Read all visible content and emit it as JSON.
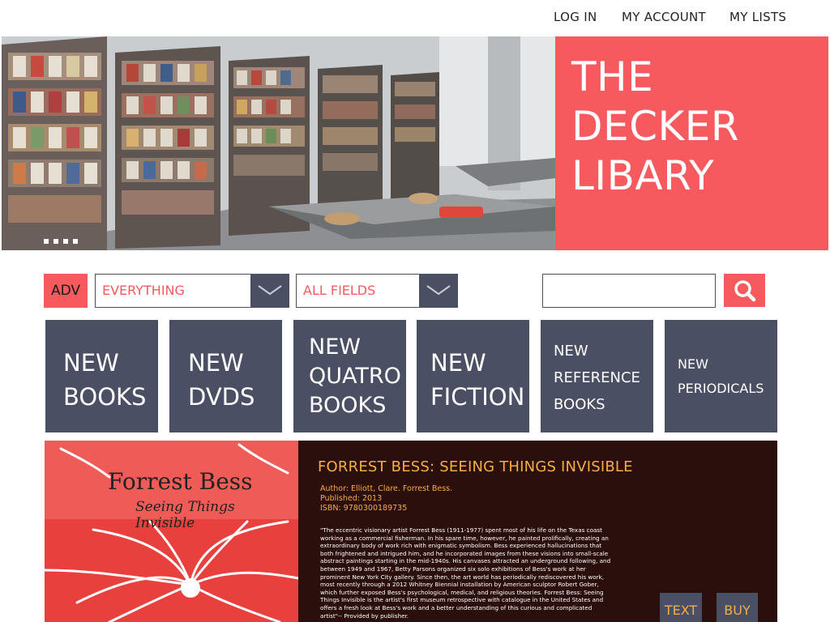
{
  "topnav": {
    "login": "LOG IN",
    "account": "MY ACCOUNT",
    "lists": "MY LISTS"
  },
  "hero": {
    "title_line1": "THE",
    "title_line2": "DECKER",
    "title_line3": "LIBARY",
    "carousel_dots": 4
  },
  "search": {
    "adv_label": "ADV",
    "scope_select": "EVERYTHING",
    "field_select": "ALL FIELDS",
    "query": ""
  },
  "tiles": [
    {
      "line1": "NEW",
      "line2": "BOOKS"
    },
    {
      "line1": "NEW",
      "line2": "DVDS"
    },
    {
      "line1": "NEW",
      "line2": "QUATRO",
      "line3": "BOOKS"
    },
    {
      "line1": "NEW",
      "line2": "FICTION"
    },
    {
      "line1": "NEW",
      "line2": "REFERENCE",
      "line3": "BOOKS"
    },
    {
      "line1": "NEW",
      "line2": "PERIODICALS"
    }
  ],
  "featured": {
    "cover_author": "Forrest Bess",
    "cover_subtitle": "Seeing Things Invisible",
    "title": "FORREST BESS: SEEING THINGS INVISIBLE",
    "author": "Author: Elliott, Clare. Forrest Bess.",
    "published": "Published: 2013",
    "isbn": "ISBN: 9780300189735",
    "description": "\"The eccentric visionary artist Forrest Bess (1911-1977) spent most of his life on the Texas coast working as a commercial fisherman. In his spare time, however, he painted prolifically, creating an extraordinary body of work rich with enigmatic symbolism. Bess experienced hallucinations that both frightened and intrigued him, and he incorporated images from these visions into small-scale abstract paintings starting in the mid-1940s. His canvases attracted an underground following, and between 1949 and 1967, Betty Parsons organized six solo exhibitions of Bess's work at her prominent New York City gallery. Since then, the art world has periodically rediscovered his work, most recently through a 2012 Whitney Biennial installation by American sculptor Robert Gober, which further exposed Bess's psychological, medical, and religious theories. Forrest Bess: Seeing Things Invisible is the artist's first museum retrospective with catalogue in the United States and offers a fresh look at Bess's work and a better understanding of this curious and complicated artist\"-- Provided by publisher.",
    "text_button": "TEXT",
    "buy_button": "BUY"
  },
  "colors": {
    "accent": "#f65a5f",
    "slate": "#4a4f63",
    "gold": "#f7ad46",
    "feature_bg": "#2a0f0c"
  }
}
